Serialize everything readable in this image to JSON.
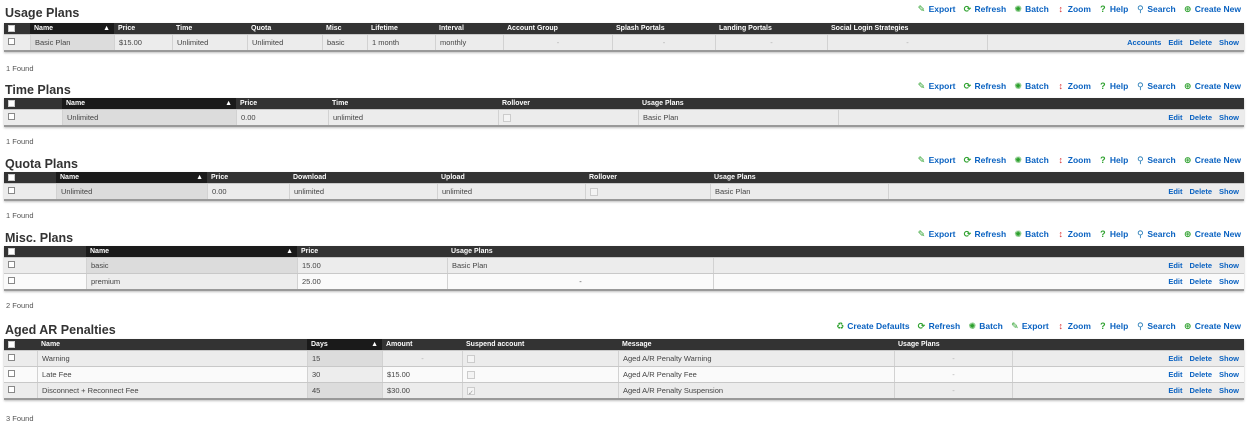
{
  "toolbar_std": {
    "export": "Export",
    "refresh": "Refresh",
    "batch": "Batch",
    "zoom": "Zoom",
    "help": "Help",
    "search": "Search",
    "create": "Create New"
  },
  "toolbar_aged": {
    "create_defaults": "Create Defaults",
    "refresh": "Refresh",
    "batch": "Batch",
    "export": "Export",
    "zoom": "Zoom",
    "help": "Help",
    "search": "Search",
    "create": "Create New"
  },
  "actions": {
    "accounts": "Accounts",
    "edit": "Edit",
    "delete": "Delete",
    "show": "Show"
  },
  "colors": {
    "header_bg": "#333333",
    "link": "#0a62c1",
    "row_bg": "#ececec"
  },
  "usage": {
    "title": "Usage Plans",
    "headers": [
      "Name",
      "Price",
      "Time",
      "Quota",
      "Misc",
      "Lifetime",
      "Interval",
      "Account Group",
      "Splash Portals",
      "Landing Portals",
      "Social Login Strategies"
    ],
    "rows": [
      {
        "name": "Basic Plan",
        "price": "$15.00",
        "time": "Unlimited",
        "quota": "Unlimited",
        "misc": "basic",
        "lifetime": "1 month",
        "interval": "monthly",
        "group": "-",
        "splash": "-",
        "landing": "-",
        "social": "-"
      }
    ],
    "found": "1 Found"
  },
  "time": {
    "title": "Time Plans",
    "headers": [
      "Name",
      "Price",
      "Time",
      "Rollover",
      "Usage Plans"
    ],
    "rows": [
      {
        "name": "Unlimited",
        "price": "0.00",
        "time": "unlimited",
        "usage": "Basic Plan"
      }
    ],
    "found": "1 Found"
  },
  "quota": {
    "title": "Quota Plans",
    "headers": [
      "Name",
      "Price",
      "Download",
      "Upload",
      "Rollover",
      "Usage Plans"
    ],
    "rows": [
      {
        "name": "Unlimited",
        "price": "0.00",
        "download": "unlimited",
        "upload": "unlimited",
        "usage": "Basic Plan"
      }
    ],
    "found": "1 Found"
  },
  "misc": {
    "title": "Misc. Plans",
    "headers": [
      "Name",
      "Price",
      "Usage Plans"
    ],
    "rows": [
      {
        "name": "basic",
        "price": "15.00",
        "usage": "Basic Plan"
      },
      {
        "name": "premium",
        "price": "25.00",
        "usage": "-"
      }
    ],
    "found": "2 Found"
  },
  "aged": {
    "title": "Aged AR Penalties",
    "headers": [
      "Name",
      "Days",
      "Amount",
      "Suspend account",
      "Message",
      "Usage Plans"
    ],
    "rows": [
      {
        "name": "Warning",
        "days": "15",
        "amount": "-",
        "message": "Aged A/R Penalty Warning",
        "usage": "-"
      },
      {
        "name": "Late Fee",
        "days": "30",
        "amount": "$15.00",
        "message": "Aged A/R Penalty Fee",
        "usage": "-"
      },
      {
        "name": "Disconnect + Reconnect Fee",
        "days": "45",
        "amount": "$30.00",
        "message": "Aged A/R Penalty Suspension",
        "usage": "-"
      }
    ],
    "found": "3 Found"
  }
}
